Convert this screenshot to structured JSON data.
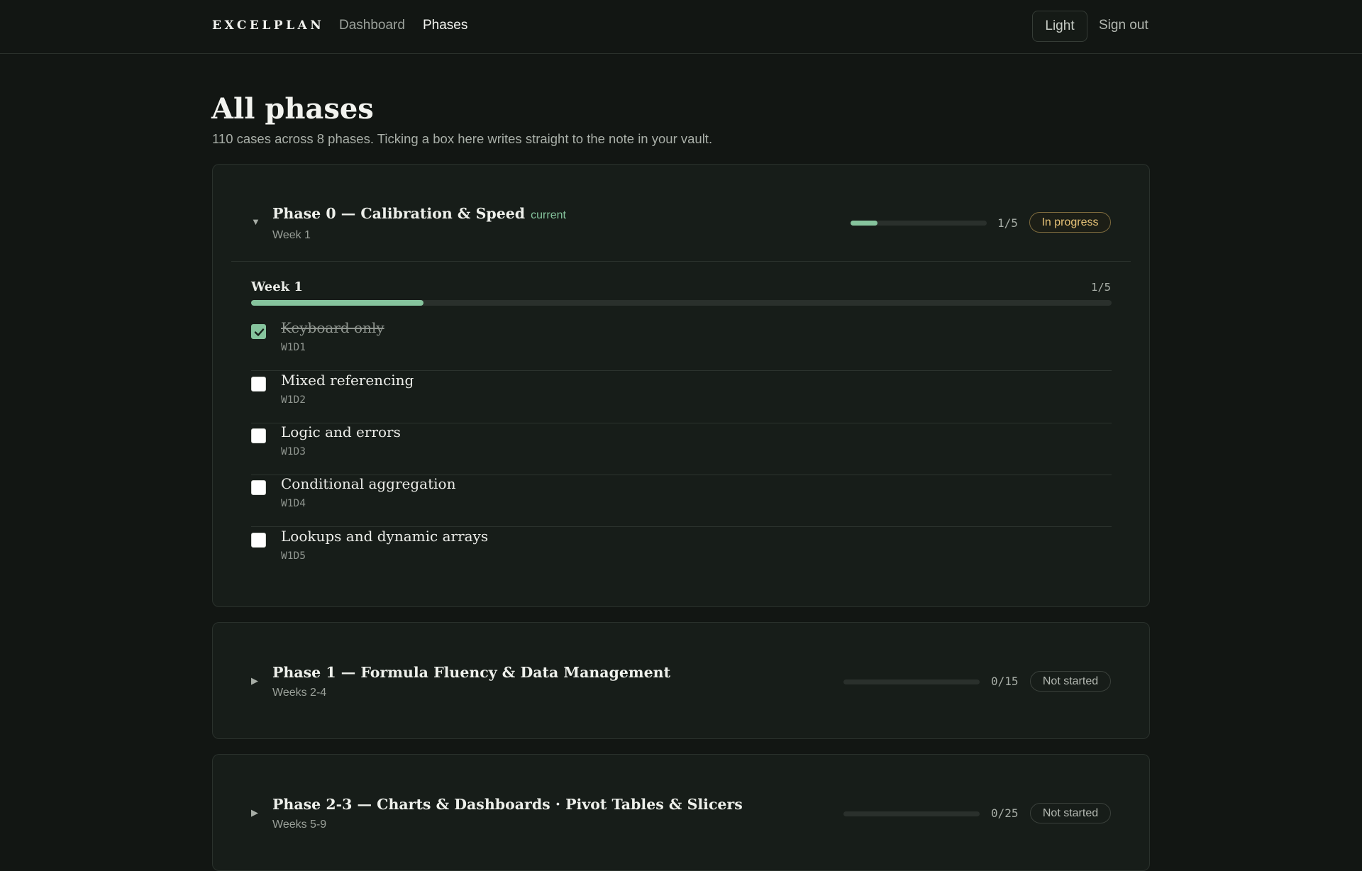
{
  "nav": {
    "brand": "EXCELPLAN",
    "links": [
      "Dashboard",
      "Phases"
    ],
    "active": "Phases",
    "theme_button": "Light",
    "sign_out": "Sign out"
  },
  "header": {
    "title": "All phases",
    "subtitle": "110 cases across 8 phases. Ticking a box here writes straight to the note in your vault."
  },
  "colors": {
    "accent": "#86c49d",
    "in_progress": "#e6c277",
    "background": "#121613"
  },
  "phases": [
    {
      "title": "Phase 0 — Calibration & Speed",
      "tag": "current",
      "weeks": "Week 1",
      "expanded": true,
      "count": "1/5",
      "progress": 0.2,
      "status": "In progress",
      "caret_icon": "caret-down-icon",
      "week": {
        "label": "Week 1",
        "count": "1/5",
        "progress": 0.2,
        "tasks": [
          {
            "name": "Keyboard only",
            "code": "W1D1",
            "done": true
          },
          {
            "name": "Mixed referencing",
            "code": "W1D2",
            "done": false
          },
          {
            "name": "Logic and errors",
            "code": "W1D3",
            "done": false
          },
          {
            "name": "Conditional aggregation",
            "code": "W1D4",
            "done": false
          },
          {
            "name": "Lookups and dynamic arrays",
            "code": "W1D5",
            "done": false
          }
        ]
      }
    },
    {
      "title": "Phase 1 — Formula Fluency & Data Management",
      "weeks": "Weeks 2-4",
      "expanded": false,
      "count": "0/15",
      "progress": 0,
      "status": "Not started",
      "caret_icon": "caret-right-icon"
    },
    {
      "title": "Phase 2-3 — Charts & Dashboards · Pivot Tables & Slicers",
      "weeks": "Weeks 5-9",
      "expanded": false,
      "count": "0/25",
      "progress": 0,
      "status": "Not started",
      "caret_icon": "caret-right-icon"
    }
  ]
}
